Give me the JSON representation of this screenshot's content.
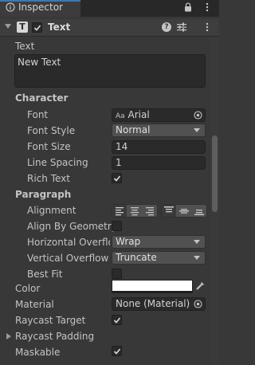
{
  "tab": {
    "label": "Inspector",
    "icon": "info-icon",
    "lock_icon": "lock-icon",
    "menu_icon": "kebab-menu-icon"
  },
  "component": {
    "title": "Text",
    "enabled": true,
    "icons": [
      "fold-arrow-icon",
      "text-component-icon",
      "help-icon",
      "presets-icon",
      "kebab-menu-icon"
    ],
    "badge": "T",
    "help": "?"
  },
  "text": {
    "label": "Text",
    "value": "New Text"
  },
  "character": {
    "heading": "Character",
    "font": {
      "label": "Font",
      "prefix": "Aa",
      "value": "Arial"
    },
    "font_style": {
      "label": "Font Style",
      "value": "Normal"
    },
    "font_size": {
      "label": "Font Size",
      "value": "14"
    },
    "line_spacing": {
      "label": "Line Spacing",
      "value": "1"
    },
    "rich_text": {
      "label": "Rich Text",
      "checked": true
    }
  },
  "paragraph": {
    "heading": "Paragraph",
    "alignment": {
      "label": "Alignment",
      "horizontal": [
        "left",
        "center",
        "right"
      ],
      "vertical": [
        "top",
        "middle",
        "bottom"
      ],
      "active_h": "left",
      "active_v": "top"
    },
    "align_by_geometry": {
      "label": "Align By Geometry",
      "checked": false
    },
    "horizontal_overflow": {
      "label": "Horizontal Overflow",
      "value": "Wrap"
    },
    "vertical_overflow": {
      "label": "Vertical Overflow",
      "value": "Truncate"
    },
    "best_fit": {
      "label": "Best Fit",
      "checked": false
    }
  },
  "color": {
    "label": "Color",
    "value": "#ffffff"
  },
  "material": {
    "label": "Material",
    "value": "None (Material)"
  },
  "raycast_target": {
    "label": "Raycast Target",
    "checked": true
  },
  "raycast_padding": {
    "label": "Raycast Padding"
  },
  "maskable": {
    "label": "Maskable",
    "checked": true
  },
  "colors": {
    "accent": "#3a79bb",
    "background": "#383838",
    "field": "#2a2a2a",
    "dropdown": "#515151"
  }
}
